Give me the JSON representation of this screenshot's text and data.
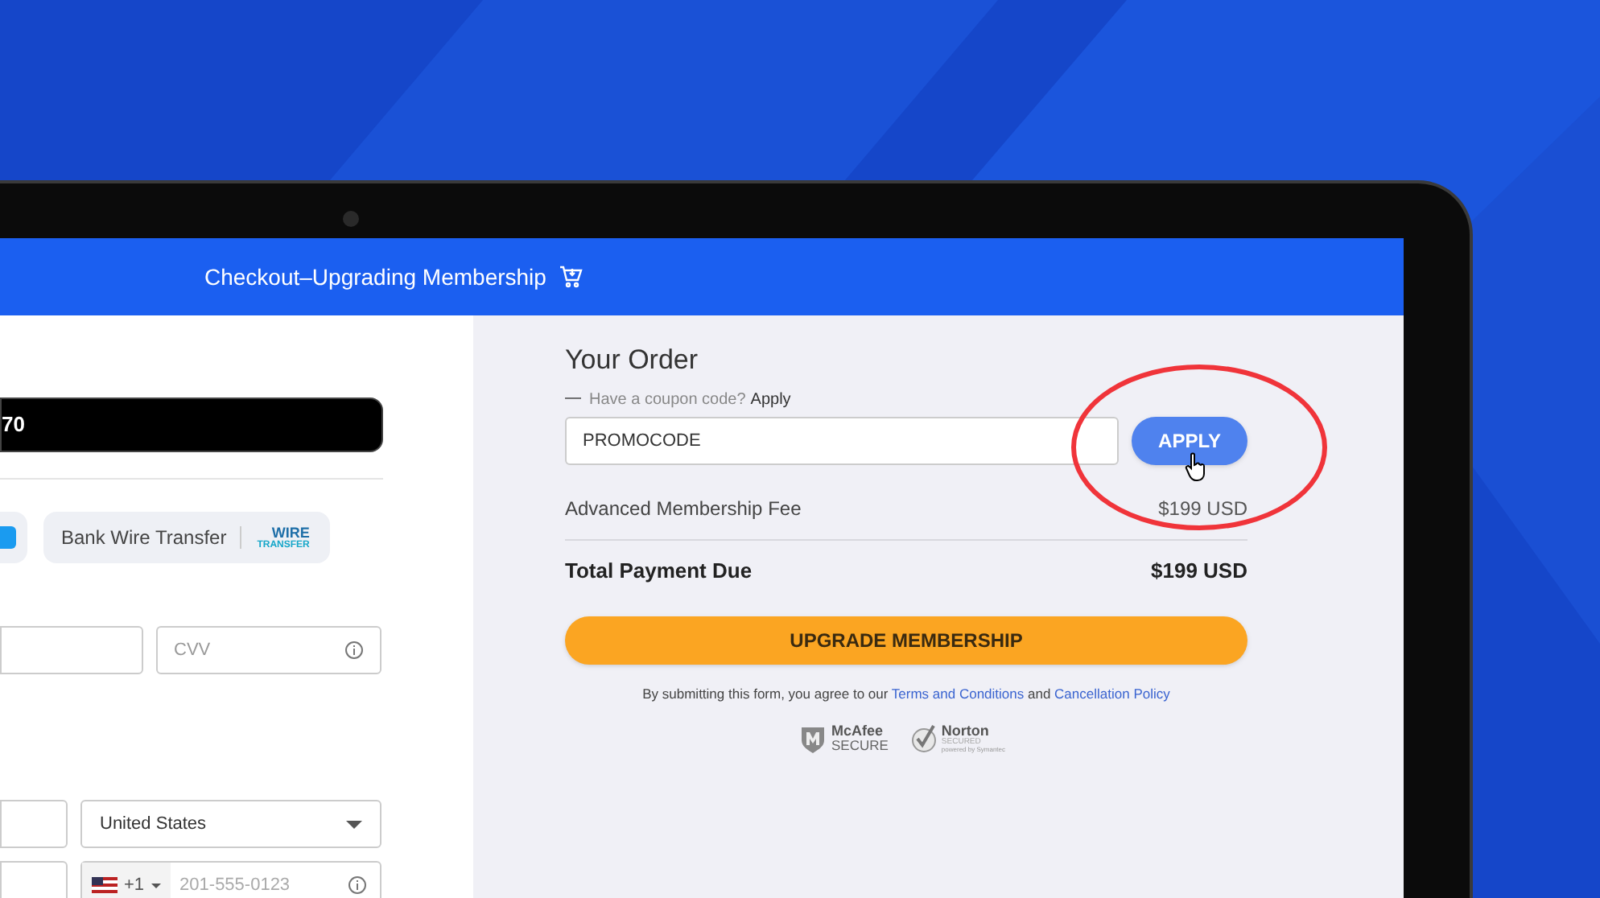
{
  "header": {
    "title": "Checkout–Upgrading Membership"
  },
  "payment": {
    "card_bar": {
      "text": "70"
    },
    "methods": [
      {
        "kind": "cut"
      },
      {
        "kind": "wire",
        "label": "Bank Wire Transfer",
        "logo_text": [
          "WIRE",
          "TRANSFER"
        ]
      }
    ],
    "cvv": {
      "placeholder": "CVV"
    },
    "country": {
      "value": "United States"
    },
    "phone": {
      "code": "+1",
      "placeholder": "201-555-0123"
    }
  },
  "order": {
    "title": "Your Order",
    "coupon_toggle": {
      "expanded": true,
      "icon": "—",
      "prompt": "Have a coupon code?",
      "link": "Apply"
    },
    "coupon": {
      "value": "PROMOCODE",
      "button": "APPLY"
    },
    "lines": [
      {
        "kind": "item",
        "label": "Advanced Membership Fee",
        "amount": "$199 USD"
      },
      {
        "kind": "total",
        "label": "Total Payment Due",
        "amount": "$199 USD"
      }
    ],
    "submit": "UPGRADE MEMBERSHIP",
    "legal": {
      "before": "By submitting this form, you agree to our",
      "link1": "Terms and Conditions",
      "middle": "and",
      "link2": "Cancellation Policy"
    },
    "badges": [
      {
        "kind": "mcafee",
        "name": "McAfee",
        "sub": "SECURE"
      },
      {
        "kind": "norton",
        "name": "Norton",
        "sub": "SECURED",
        "note": "powered by Symantec"
      }
    ]
  }
}
